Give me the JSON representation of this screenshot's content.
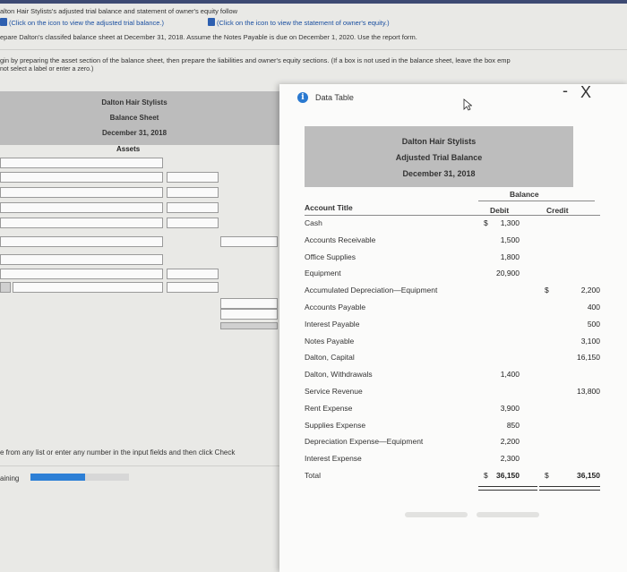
{
  "header": {
    "line1": "alton Hair Stylists's adjusted trial balance and statement of owner's equity follow",
    "link_trial": "(Click on the icon to view the adjusted trial balance.)",
    "link_equity": "(Click on the icon to view the statement of owner's equity.)",
    "line3": "epare Dalton's classifed balance sheet at December 31, 2018. Assume the Notes Payable is due on December 1, 2020. Use the report form.",
    "line4": "gin by preparing the asset section of the balance sheet, then prepare the liabilities and owner's equity sections. (If a box is not used in the balance sheet, leave the box emp",
    "line5": "not select a label or enter a zero.)"
  },
  "balance_sheet": {
    "company": "Dalton Hair Stylists",
    "title": "Balance Sheet",
    "date": "December 31, 2018",
    "section": "Assets"
  },
  "footer": {
    "hint": "e from any list or enter any number in the input fields and then click Check",
    "remaining_label": "aining",
    "progress": 0.55
  },
  "modal": {
    "title": "Data Table",
    "minimize": "-",
    "close": "X",
    "company": "Dalton Hair Stylists",
    "report": "Adjusted Trial Balance",
    "date": "December 31, 2018",
    "balance_label": "Balance",
    "col_account": "Account Title",
    "col_debit": "Debit",
    "col_credit": "Credit",
    "rows": [
      {
        "title": "Cash",
        "dsign": "$",
        "debit": "1,300",
        "csign": "",
        "credit": ""
      },
      {
        "title": "Accounts Receivable",
        "dsign": "",
        "debit": "1,500",
        "csign": "",
        "credit": ""
      },
      {
        "title": "Office Supplies",
        "dsign": "",
        "debit": "1,800",
        "csign": "",
        "credit": ""
      },
      {
        "title": "Equipment",
        "dsign": "",
        "debit": "20,900",
        "csign": "",
        "credit": ""
      },
      {
        "title": "Accumulated Depreciation—Equipment",
        "dsign": "",
        "debit": "",
        "csign": "$",
        "credit": "2,200"
      },
      {
        "title": "Accounts Payable",
        "dsign": "",
        "debit": "",
        "csign": "",
        "credit": "400"
      },
      {
        "title": "Interest Payable",
        "dsign": "",
        "debit": "",
        "csign": "",
        "credit": "500"
      },
      {
        "title": "Notes Payable",
        "dsign": "",
        "debit": "",
        "csign": "",
        "credit": "3,100"
      },
      {
        "title": "Dalton, Capital",
        "dsign": "",
        "debit": "",
        "csign": "",
        "credit": "16,150"
      },
      {
        "title": "Dalton, Withdrawals",
        "dsign": "",
        "debit": "1,400",
        "csign": "",
        "credit": ""
      },
      {
        "title": "Service Revenue",
        "dsign": "",
        "debit": "",
        "csign": "",
        "credit": "13,800"
      },
      {
        "title": "Rent Expense",
        "dsign": "",
        "debit": "3,900",
        "csign": "",
        "credit": ""
      },
      {
        "title": "Supplies Expense",
        "dsign": "",
        "debit": "850",
        "csign": "",
        "credit": ""
      },
      {
        "title": "Depreciation Expense—Equipment",
        "dsign": "",
        "debit": "2,200",
        "csign": "",
        "credit": ""
      },
      {
        "title": "Interest Expense",
        "dsign": "",
        "debit": "2,300",
        "csign": "",
        "credit": ""
      }
    ],
    "total": {
      "title": "Total",
      "dsign": "$",
      "debit": "36,150",
      "csign": "$",
      "credit": "36,150"
    }
  }
}
